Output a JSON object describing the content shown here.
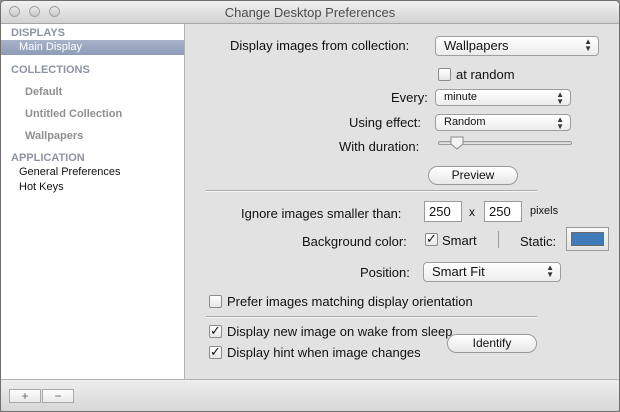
{
  "window": {
    "title": "Change Desktop Preferences"
  },
  "sidebar": {
    "displays_header": "DISPLAYS",
    "main_display": "Main Display",
    "collections_header": "COLLECTIONS",
    "collections": [
      "Default",
      "Untitled Collection",
      "Wallpapers"
    ],
    "application_header": "APPLICATION",
    "application_items": [
      "General Preferences",
      "Hot Keys"
    ]
  },
  "bottom": {
    "add": "+",
    "remove": "−"
  },
  "form": {
    "collection_label": "Display images from collection:",
    "collection_value": "Wallpapers",
    "at_random_label": "at random",
    "at_random_checked": false,
    "every_label": "Every:",
    "every_value": "minute",
    "effect_label": "Using effect:",
    "effect_value": "Random",
    "duration_label": "With duration:",
    "duration_value": 0.1,
    "preview_label": "Preview",
    "ignore_label": "Ignore images smaller than:",
    "ignore_width": "250",
    "ignore_x": "x",
    "ignore_height": "250",
    "ignore_unit": "pixels",
    "bgcolor_label": "Background color:",
    "smart_label": "Smart",
    "smart_checked": true,
    "static_label": "Static:",
    "static_color": "#3f7ab9",
    "position_label": "Position:",
    "position_value": "Smart Fit",
    "prefer_label": "Prefer images matching display orientation",
    "prefer_checked": false,
    "wake_label": "Display new image on wake from sleep",
    "wake_checked": true,
    "hint_label": "Display hint when image changes",
    "hint_checked": true,
    "identify_label": "Identify"
  }
}
